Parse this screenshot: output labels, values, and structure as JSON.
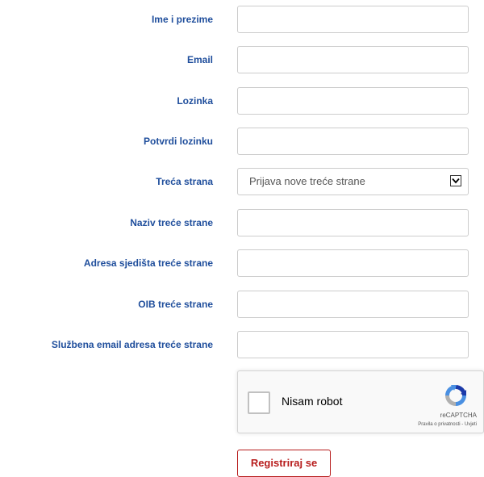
{
  "form": {
    "full_name": {
      "label": "Ime i prezime",
      "value": "",
      "placeholder": ""
    },
    "email": {
      "label": "Email",
      "value": "",
      "placeholder": ""
    },
    "password": {
      "label": "Lozinka",
      "value": "",
      "placeholder": ""
    },
    "confirm_password": {
      "label": "Potvrdi lozinku",
      "value": "",
      "placeholder": ""
    },
    "third_party": {
      "label": "Treća strana",
      "selected": "Prijava nove treće strane"
    },
    "third_party_name": {
      "label": "Naziv treće strane",
      "value": "",
      "placeholder": ""
    },
    "third_party_address": {
      "label": "Adresa sjedišta treće strane",
      "value": "",
      "placeholder": ""
    },
    "third_party_oib": {
      "label": "OIB treće strane",
      "value": "",
      "placeholder": ""
    },
    "third_party_email": {
      "label": "Službena email adresa treće strane",
      "value": "",
      "placeholder": ""
    }
  },
  "captcha": {
    "label": "Nisam robot",
    "brand": "reCAPTCHA",
    "privacy": "Pravila o privatnosti",
    "separator": " - ",
    "terms": "Uvjeti",
    "logo_icon": "recaptcha-logo-icon"
  },
  "submit": {
    "label": "Registriraj se"
  },
  "colors": {
    "label": "#1f4e9c",
    "submit": "#b71c1c",
    "input_border": "#cccccc"
  }
}
